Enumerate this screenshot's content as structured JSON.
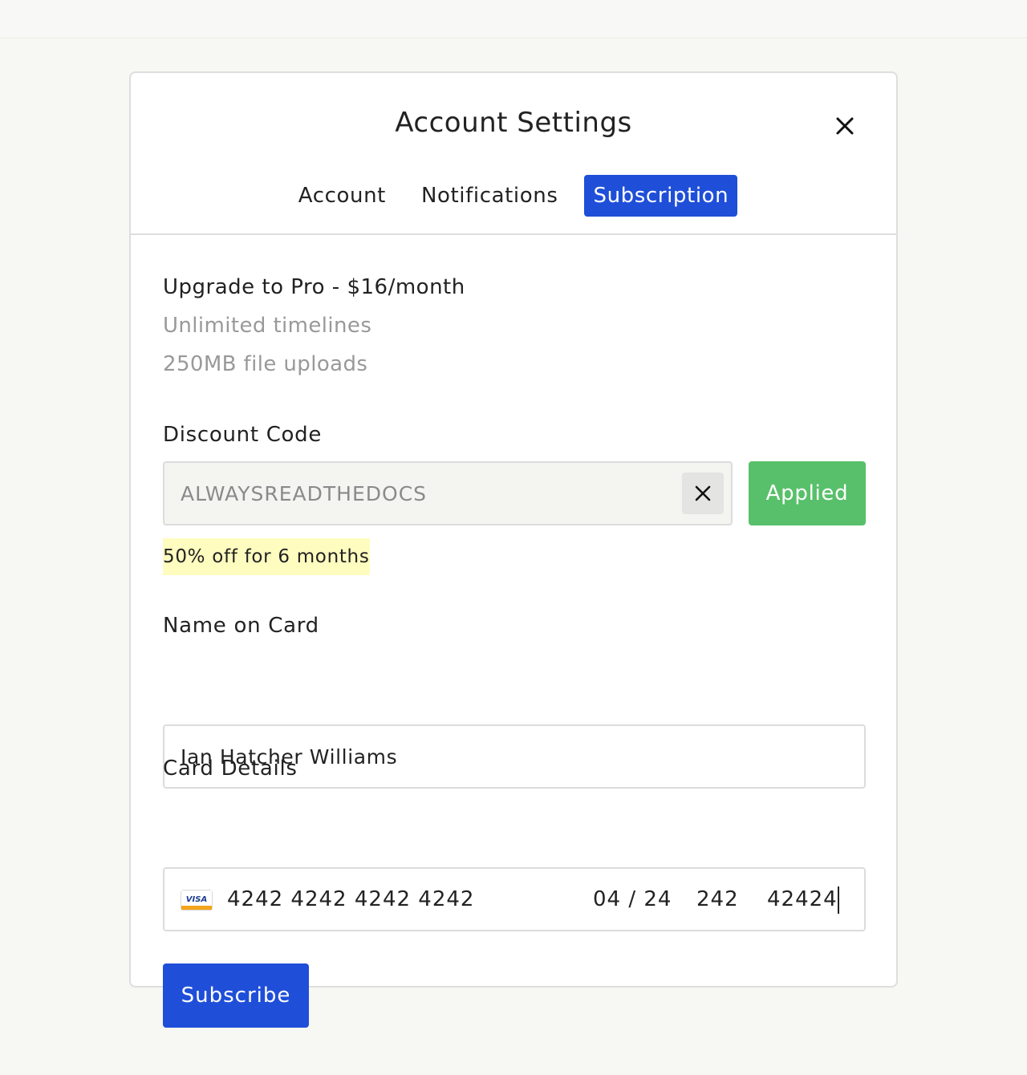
{
  "modal": {
    "title": "Account Settings",
    "tabs": [
      {
        "label": "Account",
        "active": false
      },
      {
        "label": "Notifications",
        "active": false
      },
      {
        "label": "Subscription",
        "active": true
      }
    ]
  },
  "plan": {
    "title": "Upgrade to Pro - $16/month",
    "features": [
      "Unlimited timelines",
      "250MB file uploads"
    ]
  },
  "discount": {
    "label": "Discount Code",
    "value": "ALWAYSREADTHEDOCS",
    "button_label": "Applied",
    "note": "50% off for 6 months"
  },
  "name_on_card": {
    "label": "Name on Card",
    "value": "Ian Hatcher Williams"
  },
  "card": {
    "label": "Card Details",
    "brand": "visa-icon",
    "brand_text": "VISA",
    "number": "4242 4242 4242 4242",
    "expiry": "04 / 24",
    "cvc": "242",
    "zip": "42424"
  },
  "subscribe_label": "Subscribe",
  "colors": {
    "primary": "#1f4fd8",
    "success": "#58c06a",
    "highlight": "#fefcbf",
    "background": "#f7f7f3"
  }
}
